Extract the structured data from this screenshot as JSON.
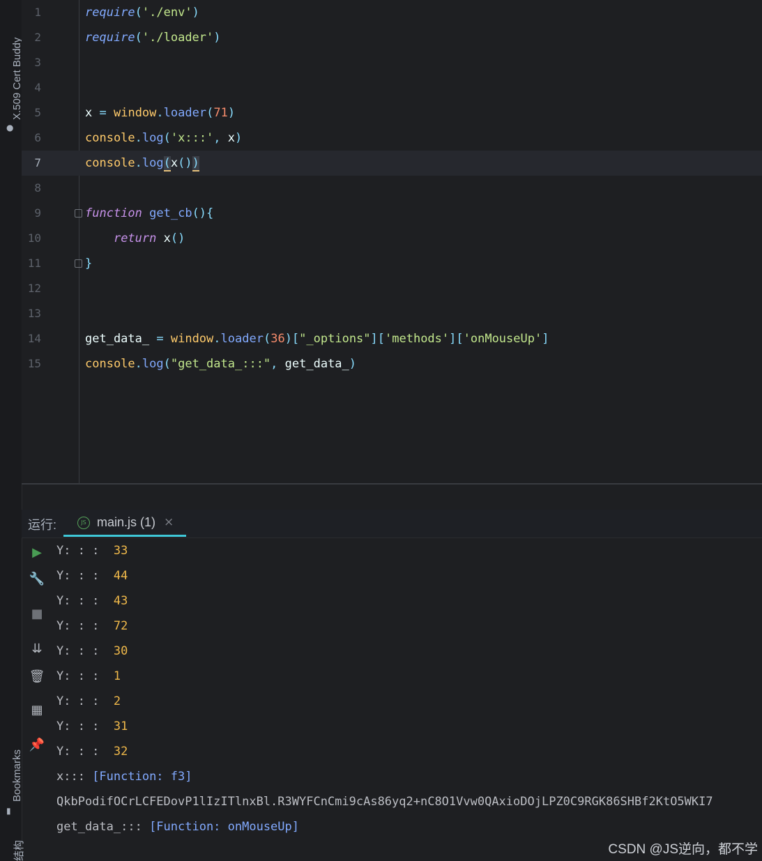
{
  "side_panels": {
    "cert_buddy": "X.509 Cert Buddy",
    "bookmarks": "Bookmarks",
    "structure": "结构"
  },
  "editor": {
    "current_line": 7,
    "lines": [
      {
        "n": "1",
        "tokens": [
          [
            "fn-i",
            "require"
          ],
          [
            "pn",
            "("
          ],
          [
            "str",
            "'./env'"
          ],
          [
            "pn",
            ")"
          ]
        ]
      },
      {
        "n": "2",
        "tokens": [
          [
            "fn-i",
            "require"
          ],
          [
            "pn",
            "("
          ],
          [
            "str",
            "'./loader'"
          ],
          [
            "pn",
            ")"
          ]
        ]
      },
      {
        "n": "3",
        "tokens": []
      },
      {
        "n": "4",
        "tokens": []
      },
      {
        "n": "5",
        "tokens": [
          [
            "txt",
            "x "
          ],
          [
            "pn",
            "="
          ],
          [
            "txt",
            " "
          ],
          [
            "obj",
            "window"
          ],
          [
            "pn",
            "."
          ],
          [
            "fn",
            "loader"
          ],
          [
            "pn",
            "("
          ],
          [
            "num",
            "71"
          ],
          [
            "pn",
            ")"
          ]
        ]
      },
      {
        "n": "6",
        "tokens": [
          [
            "obj",
            "console"
          ],
          [
            "pn",
            "."
          ],
          [
            "fn",
            "log"
          ],
          [
            "pn",
            "("
          ],
          [
            "str",
            "'x:::'"
          ],
          [
            "pn",
            ","
          ],
          [
            "txt",
            " x"
          ],
          [
            "pn",
            ")"
          ]
        ]
      },
      {
        "n": "7",
        "tokens": [
          [
            "obj",
            "console"
          ],
          [
            "pn",
            "."
          ],
          [
            "fn",
            "log"
          ],
          [
            "hl",
            "("
          ],
          [
            "txt",
            "x"
          ],
          [
            "pn",
            "()"
          ],
          [
            "hl",
            ")"
          ]
        ]
      },
      {
        "n": "8",
        "tokens": []
      },
      {
        "n": "9",
        "fold": true,
        "tokens": [
          [
            "kw",
            "function"
          ],
          [
            "txt",
            " "
          ],
          [
            "fn",
            "get_cb"
          ],
          [
            "pn",
            "(){"
          ]
        ]
      },
      {
        "n": "10",
        "tokens": [
          [
            "txt",
            "    "
          ],
          [
            "kw",
            "return"
          ],
          [
            "txt",
            " x"
          ],
          [
            "pn",
            "()"
          ]
        ]
      },
      {
        "n": "11",
        "fold": true,
        "tokens": [
          [
            "pn",
            "}"
          ]
        ]
      },
      {
        "n": "12",
        "tokens": []
      },
      {
        "n": "13",
        "tokens": []
      },
      {
        "n": "14",
        "tokens": [
          [
            "txt",
            "get_data_ "
          ],
          [
            "pn",
            "="
          ],
          [
            "txt",
            " "
          ],
          [
            "obj",
            "window"
          ],
          [
            "pn",
            "."
          ],
          [
            "fn",
            "loader"
          ],
          [
            "pn",
            "("
          ],
          [
            "num",
            "36"
          ],
          [
            "pn",
            ")["
          ],
          [
            "str",
            "\"_options\""
          ],
          [
            "pn",
            "]["
          ],
          [
            "str",
            "'methods'"
          ],
          [
            "pn",
            "]["
          ],
          [
            "str",
            "'onMouseUp'"
          ],
          [
            "pn",
            "]"
          ]
        ]
      },
      {
        "n": "15",
        "tokens": [
          [
            "obj",
            "console"
          ],
          [
            "pn",
            "."
          ],
          [
            "fn",
            "log"
          ],
          [
            "pn",
            "("
          ],
          [
            "str",
            "\"get_data_:::\""
          ],
          [
            "pn",
            ","
          ],
          [
            "txt",
            " get_data_"
          ],
          [
            "pn",
            ")"
          ]
        ]
      }
    ]
  },
  "run_panel": {
    "label": "运行:",
    "tab_label": "main.js (1)",
    "tab_icon": "JS",
    "close_glyph": "×",
    "tools": [
      {
        "name": "rerun-icon",
        "glyph": "▶",
        "color": "#499c54"
      },
      {
        "name": "wrench-icon",
        "glyph": "🔧",
        "color": "#b0b4bb"
      },
      {
        "name": "stop-icon",
        "glyph": "■",
        "color": "#6e7177"
      },
      {
        "name": "scroll-to-end-icon",
        "glyph": "⇊",
        "color": "#b0b4bb"
      },
      {
        "name": "trash-icon",
        "glyph": "🗑",
        "color": "#b0b4bb"
      },
      {
        "name": "layout-icon",
        "glyph": "▦",
        "color": "#b0b4bb"
      },
      {
        "name": "pin-icon",
        "glyph": "📌",
        "color": "#b0b4bb"
      }
    ],
    "output": [
      {
        "prefix": "Y: : :  ",
        "value": "33"
      },
      {
        "prefix": "Y: : :  ",
        "value": "44"
      },
      {
        "prefix": "Y: : :  ",
        "value": "43"
      },
      {
        "prefix": "Y: : :  ",
        "value": "72"
      },
      {
        "prefix": "Y: : :  ",
        "value": "30"
      },
      {
        "prefix": "Y: : :  ",
        "value": "1"
      },
      {
        "prefix": "Y: : :  ",
        "value": "2"
      },
      {
        "prefix": "Y: : :  ",
        "value": "31"
      },
      {
        "prefix": "Y: : :  ",
        "value": "32"
      },
      {
        "prefix": "x::: ",
        "fn": "[Function: f3]"
      },
      {
        "prefix": "QkbPodifOCrLCFEDovP1lIzITlnxBl.R3WYFCnCmi9cAs86yq2+nC8O1Vvw0QAxioDOjLPZ0C9RGK86SHBf2KtO5WKI7"
      },
      {
        "prefix": "get_data_::: ",
        "fn": "[Function: onMouseUp]"
      }
    ]
  },
  "watermark": "CSDN @JS逆向，都不学"
}
